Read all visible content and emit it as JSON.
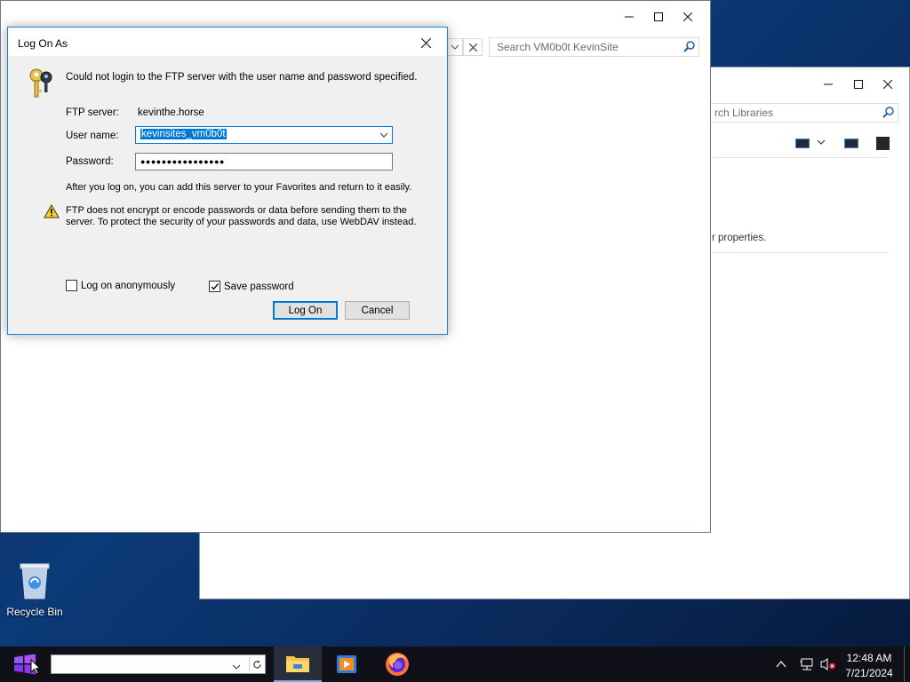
{
  "desktop": {
    "recycle_bin_label": "Recycle Bin"
  },
  "explorer_back": {
    "search_placeholder": "rch Libraries",
    "properties_text": "r properties."
  },
  "explorer_front": {
    "search_placeholder": "Search VM0b0t KevinSite"
  },
  "dialog": {
    "title": "Log On As",
    "message": "Could not login to the FTP server with the user name and password specified.",
    "ftp_server_label": "FTP server:",
    "ftp_server_value": "kevinthe.horse",
    "username_label": "User name:",
    "username_value": "kevinsites_vm0b0t",
    "password_label": "Password:",
    "password_value": "●●●●●●●●●●●●●●●●",
    "info_text": "After you log on, you can add this server to your Favorites and return to it easily.",
    "warning_text": "FTP does not encrypt or encode passwords or data before sending them to the server.  To protect the security of your passwords and data, use WebDAV instead.",
    "anonymous_label": "Log on anonymously",
    "anonymous_checked": false,
    "save_password_label": "Save password",
    "save_password_checked": true,
    "logon_button": "Log On",
    "cancel_button": "Cancel"
  },
  "taskbar": {
    "address_value": "",
    "clock_time": "12:48 AM",
    "clock_date": "7/21/2024",
    "pinned": [
      "start-icon",
      "file-explorer-icon",
      "media-player-icon",
      "firefox-icon"
    ]
  },
  "colors": {
    "accent": "#0078d7",
    "desktop": "#0b3a78",
    "taskbar": "#101018"
  }
}
